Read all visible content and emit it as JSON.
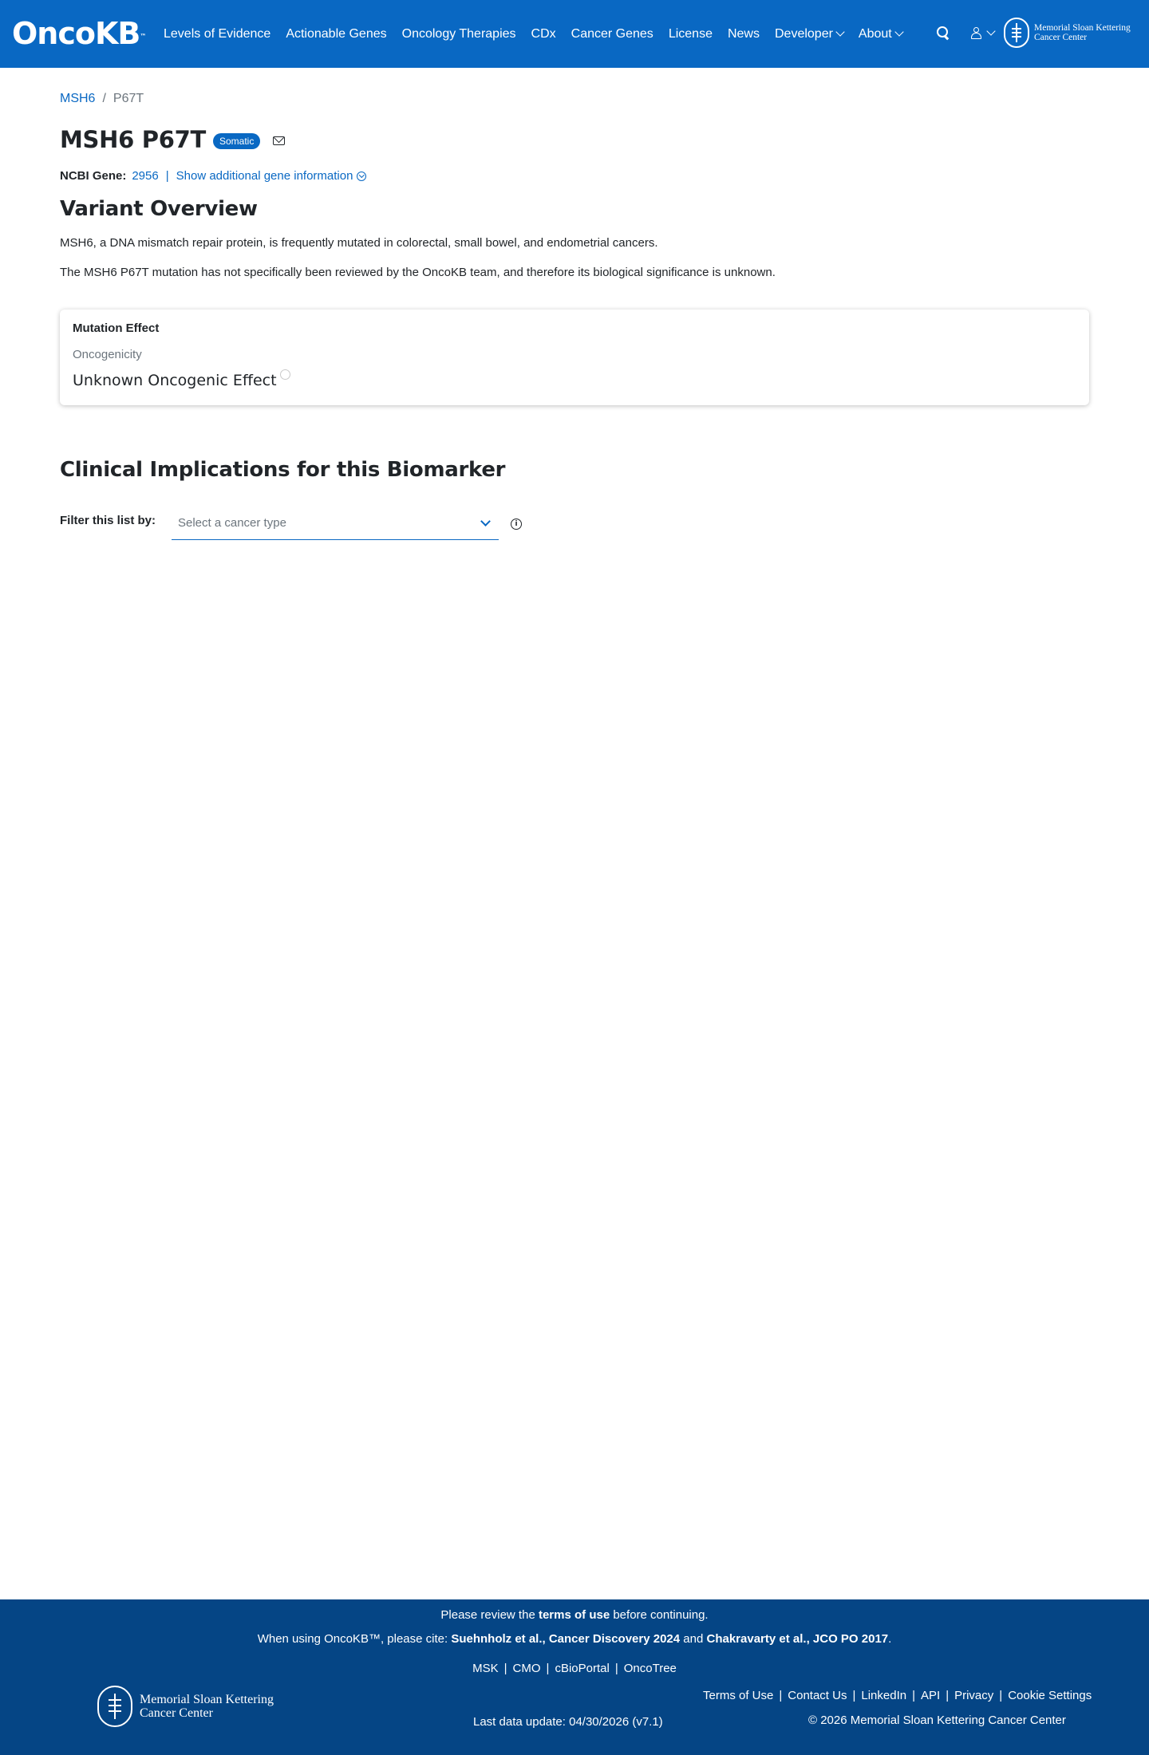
{
  "colors": {
    "brand": "#0968c3",
    "footer": "#054585",
    "text": "#212529",
    "muted": "#6c757d"
  },
  "nav": {
    "logo": "OncoKB",
    "logo_tm": "™",
    "links": [
      "Levels of Evidence",
      "Actionable Genes",
      "Oncology Therapies",
      "CDx",
      "Cancer Genes",
      "License",
      "News"
    ],
    "dropdowns": [
      "Developer",
      "About"
    ],
    "msk_line1": "Memorial Sloan Kettering",
    "msk_line2": "Cancer Center"
  },
  "breadcrumb": {
    "gene": "MSH6",
    "separator": "/",
    "current": "P67T"
  },
  "title": {
    "text": "MSH6 P67T",
    "badge": "Somatic"
  },
  "gene_info": {
    "label": "NCBI Gene:",
    "id": "2956",
    "separator": "|",
    "toggle": "Show additional gene information"
  },
  "overview": {
    "heading": "Variant Overview",
    "p1": "MSH6, a DNA mismatch repair protein, is frequently mutated in colorectal, small bowel, and endometrial cancers.",
    "p2": "The MSH6 P67T mutation has not specifically been reviewed by the OncoKB team, and therefore its biological significance is unknown."
  },
  "mutation_card": {
    "title": "Mutation Effect",
    "subtitle": "Oncogenicity",
    "value": "Unknown Oncogenic Effect"
  },
  "clinical": {
    "heading": "Clinical Implications for this Biomarker",
    "filter_label": "Filter this list by:",
    "select_placeholder": "Select a cancer type",
    "info": "i"
  },
  "footer": {
    "review_pre": "Please review the ",
    "review_link": "terms of use",
    "review_post": " before continuing.",
    "cite_pre": "When using OncoKB™, please cite: ",
    "cite_1": "Suehnholz et al., Cancer Discovery 2024",
    "cite_mid": " and ",
    "cite_2": "Chakravarty et al., JCO PO 2017",
    "cite_post": ".",
    "links": [
      "MSK",
      "CMO",
      "cBioPortal",
      "OncoTree"
    ],
    "msk_line1": "Memorial Sloan Kettering",
    "msk_line2": "Cancer Center",
    "update": "Last data update: 04/30/2026 (v7.1)",
    "right_links": [
      "Terms of Use",
      "Contact Us",
      "LinkedIn",
      "API",
      "Privacy",
      "Cookie Settings"
    ],
    "copyright": "© 2026 Memorial Sloan Kettering Cancer Center"
  }
}
